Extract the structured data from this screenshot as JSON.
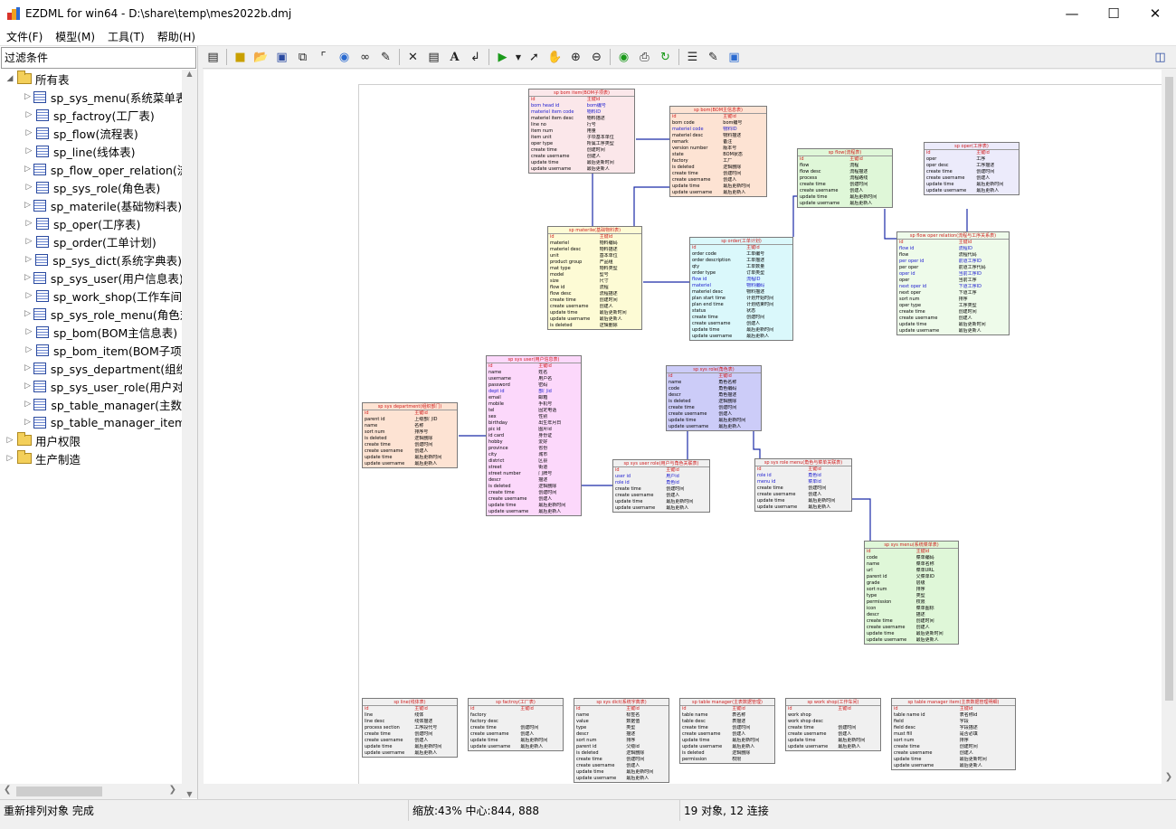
{
  "window": {
    "title": "EZDML for win64 - D:\\share\\temp\\mes2022b.dmj"
  },
  "menu": [
    "文件(F)",
    "模型(M)",
    "工具(T)",
    "帮助(H)"
  ],
  "left_panel": {
    "filter_label": "过滤条件",
    "root": "所有表",
    "tables": [
      "sp_sys_menu(系统菜单表",
      "sp_factroy(工厂表)",
      "sp_flow(流程表)",
      "sp_line(线体表)",
      "sp_flow_oper_relation(流",
      "sp_sys_role(角色表)",
      "sp_materile(基础物料表)",
      "sp_oper(工序表)",
      "sp_order(工单计划)",
      "sp_sys_dict(系统字典表)",
      "sp_sys_user(用户信息表)",
      "sp_work_shop(工作车间",
      "sp_sys_role_menu(角色对",
      "sp_bom(BOM主信息表)",
      "sp_bom_item(BOM子项",
      "sp_sys_department(组织",
      "sp_sys_user_role(用户对",
      "sp_table_manager(主数",
      "sp_table_manager_item"
    ],
    "groups": [
      "用户权限",
      "生产制造"
    ]
  },
  "toolbar_icons": [
    "panel-toggle-icon",
    "new-icon",
    "open-icon",
    "save-icon",
    "copy-model-icon",
    "tree-icon",
    "globe-icon",
    "find-icon",
    "brush-icon",
    "delete-icon",
    "table-icon",
    "text-icon",
    "link-icon",
    "run-icon",
    "run-dropdown-icon",
    "pointer-icon",
    "hand-icon",
    "zoom-in-icon",
    "zoom-out-icon",
    "eye-icon",
    "print-icon",
    "refresh-icon",
    "add-fields-icon",
    "properties-icon",
    "fit-icon",
    "layout-icon"
  ],
  "entities": [
    {
      "title": "sp bom item(BOM子项表)",
      "color": "#fbe7ea",
      "rows": [
        [
          "id",
          "主键id",
          "pk"
        ],
        [
          "bom head id",
          "bom编号",
          "fk"
        ],
        [
          "materiel item code",
          "物料ID",
          "fk"
        ],
        [
          "materiel item desc",
          "物料描述",
          ""
        ],
        [
          "line no",
          "行号",
          ""
        ],
        [
          "item num",
          "用量",
          ""
        ],
        [
          "item unit",
          "子项基本单位",
          ""
        ],
        [
          "oper type",
          "所属工序类型",
          ""
        ],
        [
          "create time",
          "创建时间",
          ""
        ],
        [
          "create username",
          "创建人",
          ""
        ],
        [
          "update time",
          "最后更新时间",
          ""
        ],
        [
          "update username",
          "最后更新人",
          ""
        ]
      ]
    },
    {
      "title": "sp bom(BOM主信息表)",
      "color": "#fde3d3",
      "rows": [
        [
          "id",
          "主键id",
          "pk"
        ],
        [
          "bom code",
          "bom编号",
          ""
        ],
        [
          "materiel code",
          "物料ID",
          "fk"
        ],
        [
          "materiel desc",
          "物料描述",
          ""
        ],
        [
          "remark",
          "备注",
          ""
        ],
        [
          "version number",
          "版本号",
          ""
        ],
        [
          "state",
          "BOM状态",
          ""
        ],
        [
          "factory",
          "工厂",
          ""
        ],
        [
          "is deleted",
          "逻辑删除",
          ""
        ],
        [
          "create time",
          "创建时间",
          ""
        ],
        [
          "create username",
          "创建人",
          ""
        ],
        [
          "update time",
          "最后更新时间",
          ""
        ],
        [
          "update username",
          "最后更新人",
          ""
        ]
      ]
    },
    {
      "title": "sp flow(流程表)",
      "color": "#dff7d8",
      "rows": [
        [
          "id",
          "主键id",
          "pk"
        ],
        [
          "flow",
          "流程",
          ""
        ],
        [
          "flow desc",
          "流程描述",
          ""
        ],
        [
          "process",
          "流程路线",
          ""
        ],
        [
          "create time",
          "创建时间",
          ""
        ],
        [
          "create username",
          "创建人",
          ""
        ],
        [
          "update time",
          "最后更新时间",
          ""
        ],
        [
          "update username",
          "最后更新人",
          ""
        ]
      ]
    },
    {
      "title": "sp oper(工序表)",
      "color": "#ecebfb",
      "rows": [
        [
          "id",
          "主键id",
          "pk"
        ],
        [
          "oper",
          "工序",
          ""
        ],
        [
          "oper desc",
          "工序描述",
          ""
        ],
        [
          "create time",
          "创建时间",
          ""
        ],
        [
          "create username",
          "创建人",
          ""
        ],
        [
          "update time",
          "最后更新时间",
          ""
        ],
        [
          "update username",
          "最后更新人",
          ""
        ]
      ]
    },
    {
      "title": "sp materile(基础物料表)",
      "color": "#fdfbd5",
      "rows": [
        [
          "id",
          "主键id",
          "pk"
        ],
        [
          "materiel",
          "物料编码",
          ""
        ],
        [
          "materiel desc",
          "物料描述",
          ""
        ],
        [
          "unit",
          "基本单位",
          ""
        ],
        [
          "product group",
          "产品组",
          ""
        ],
        [
          "mat type",
          "物料类型",
          ""
        ],
        [
          "model",
          "型号",
          ""
        ],
        [
          "size",
          "尺寸",
          ""
        ],
        [
          "flow id",
          "流程",
          ""
        ],
        [
          "flow desc",
          "流程描述",
          ""
        ],
        [
          "create time",
          "创建时间",
          ""
        ],
        [
          "create username",
          "创建人",
          ""
        ],
        [
          "update time",
          "最后更新时间",
          ""
        ],
        [
          "update username",
          "最后更新人",
          ""
        ],
        [
          "is deleted",
          "逻辑删除",
          ""
        ]
      ]
    },
    {
      "title": "sp order(工单计划)",
      "color": "#daf8fb",
      "rows": [
        [
          "id",
          "主键id",
          "pk"
        ],
        [
          "order code",
          "工单编号",
          ""
        ],
        [
          "order description",
          "工单描述",
          ""
        ],
        [
          "qty",
          "工单数量",
          ""
        ],
        [
          "order type",
          "订单类型",
          ""
        ],
        [
          "flow id",
          "流程ID",
          "fk"
        ],
        [
          "materiel",
          "物料编码",
          "fk"
        ],
        [
          "materiel desc",
          "物料描述",
          ""
        ],
        [
          "plan start time",
          "计划开始时间",
          ""
        ],
        [
          "plan end time",
          "计划结束时间",
          ""
        ],
        [
          "status",
          "状态",
          ""
        ],
        [
          "create time",
          "创建时间",
          ""
        ],
        [
          "create username",
          "创建人",
          ""
        ],
        [
          "update time",
          "最后更新时间",
          ""
        ],
        [
          "update username",
          "最后更新人",
          ""
        ]
      ]
    },
    {
      "title": "sp flow oper relation(流程与工序关系表)",
      "color": "#eefbea",
      "rows": [
        [
          "id",
          "主键id",
          "pk"
        ],
        [
          "flow id",
          "流程ID",
          "fk"
        ],
        [
          "flow",
          "流程代码",
          ""
        ],
        [
          "per oper id",
          "前道工序ID",
          "fk"
        ],
        [
          "per oper",
          "前道工序代码",
          ""
        ],
        [
          "oper id",
          "当前工序ID",
          "fk"
        ],
        [
          "oper",
          "当前工序",
          ""
        ],
        [
          "next oper id",
          "下道工序ID",
          "fk"
        ],
        [
          "next oper",
          "下道工序",
          ""
        ],
        [
          "sort num",
          "排序",
          ""
        ],
        [
          "oper type",
          "工序类型",
          ""
        ],
        [
          "create time",
          "创建时间",
          ""
        ],
        [
          "create username",
          "创建人",
          ""
        ],
        [
          "update time",
          "最后更新时间",
          ""
        ],
        [
          "update username",
          "最后更新人",
          ""
        ]
      ]
    },
    {
      "title": "sp sys user(用户信息表)",
      "color": "#fcd8fb",
      "rows": [
        [
          "id",
          "主键id",
          "pk"
        ],
        [
          "name",
          "姓名",
          ""
        ],
        [
          "username",
          "用户名",
          ""
        ],
        [
          "password",
          "密码",
          ""
        ],
        [
          "dept id",
          "部门id",
          "fk"
        ],
        [
          "email",
          "邮箱",
          ""
        ],
        [
          "mobile",
          "手机号",
          ""
        ],
        [
          "tel",
          "固定电话",
          ""
        ],
        [
          "sex",
          "性别",
          ""
        ],
        [
          "birthday",
          "出生年月日",
          ""
        ],
        [
          "pic id",
          "图片id",
          ""
        ],
        [
          "id card",
          "身份证",
          ""
        ],
        [
          "hobby",
          "爱好",
          ""
        ],
        [
          "province",
          "省份",
          ""
        ],
        [
          "city",
          "城市",
          ""
        ],
        [
          "district",
          "区县",
          ""
        ],
        [
          "street",
          "街道",
          ""
        ],
        [
          "street number",
          "门牌号",
          ""
        ],
        [
          "descr",
          "描述",
          ""
        ],
        [
          "is deleted",
          "逻辑删除",
          ""
        ],
        [
          "create time",
          "创建时间",
          ""
        ],
        [
          "create username",
          "创建人",
          ""
        ],
        [
          "update time",
          "最后更新时间",
          ""
        ],
        [
          "update username",
          "最后更新人",
          ""
        ]
      ]
    },
    {
      "title": "sp sys department(组织部门)",
      "color": "#fde3d3",
      "rows": [
        [
          "id",
          "主键id",
          "pk"
        ],
        [
          "parent id",
          "上级部门ID",
          ""
        ],
        [
          "name",
          "名称",
          ""
        ],
        [
          "sort num",
          "排序号",
          ""
        ],
        [
          "is deleted",
          "逻辑删除",
          ""
        ],
        [
          "create time",
          "创建时间",
          ""
        ],
        [
          "create username",
          "创建人",
          ""
        ],
        [
          "update time",
          "最后更新时间",
          ""
        ],
        [
          "update username",
          "最后更新人",
          ""
        ]
      ]
    },
    {
      "title": "sp sys role(角色表)",
      "color": "#ccccf8",
      "rows": [
        [
          "id",
          "主键id",
          "pk"
        ],
        [
          "name",
          "角色名称",
          ""
        ],
        [
          "code",
          "角色编码",
          ""
        ],
        [
          "descr",
          "角色描述",
          ""
        ],
        [
          "is deleted",
          "逻辑删除",
          ""
        ],
        [
          "create time",
          "创建时间",
          ""
        ],
        [
          "create username",
          "创建人",
          ""
        ],
        [
          "update time",
          "最后更新时间",
          ""
        ],
        [
          "update username",
          "最后更新人",
          ""
        ]
      ]
    },
    {
      "title": "sp sys user role(用户与角色关联表)",
      "color": "#f0f0f0",
      "rows": [
        [
          "id",
          "主键id",
          "pk"
        ],
        [
          "user id",
          "用户id",
          "fk"
        ],
        [
          "role id",
          "角色id",
          "fk"
        ],
        [
          "create time",
          "创建时间",
          ""
        ],
        [
          "create username",
          "创建人",
          ""
        ],
        [
          "update time",
          "最后更新时间",
          ""
        ],
        [
          "update username",
          "最后更新人",
          ""
        ]
      ]
    },
    {
      "title": "sp sys role menu(角色与菜单关联表)",
      "color": "#f0f0f0",
      "rows": [
        [
          "id",
          "主键id",
          "pk"
        ],
        [
          "role id",
          "角色id",
          "fk"
        ],
        [
          "menu id",
          "菜单id",
          "fk"
        ],
        [
          "create time",
          "创建时间",
          ""
        ],
        [
          "create username",
          "创建人",
          ""
        ],
        [
          "update time",
          "最后更新时间",
          ""
        ],
        [
          "update username",
          "最后更新人",
          ""
        ]
      ]
    },
    {
      "title": "sp sys menu(系统菜单表)",
      "color": "#dff7d8",
      "rows": [
        [
          "id",
          "主键id",
          "pk"
        ],
        [
          "code",
          "菜单编码",
          ""
        ],
        [
          "name",
          "菜单名称",
          ""
        ],
        [
          "url",
          "菜单URL",
          ""
        ],
        [
          "parent id",
          "父菜单ID",
          ""
        ],
        [
          "grade",
          "层级",
          ""
        ],
        [
          "sort num",
          "排序",
          ""
        ],
        [
          "type",
          "类型",
          ""
        ],
        [
          "permission",
          "权限",
          ""
        ],
        [
          "icon",
          "菜单图标",
          ""
        ],
        [
          "descr",
          "描述",
          ""
        ],
        [
          "create time",
          "创建时间",
          ""
        ],
        [
          "create username",
          "创建人",
          ""
        ],
        [
          "update time",
          "最后更新时间",
          ""
        ],
        [
          "update username",
          "最后更新人",
          ""
        ]
      ]
    },
    {
      "title": "sp line(线体表)",
      "color": "#f0f0f0",
      "rows": [
        [
          "id",
          "主键id",
          "pk"
        ],
        [
          "line",
          "线体",
          ""
        ],
        [
          "line desc",
          "线体描述",
          ""
        ],
        [
          "process section",
          "工序段代号",
          ""
        ],
        [
          "create time",
          "创建时间",
          ""
        ],
        [
          "create username",
          "创建人",
          ""
        ],
        [
          "update time",
          "最后更新时间",
          ""
        ],
        [
          "update username",
          "最后更新人",
          ""
        ]
      ]
    },
    {
      "title": "sp factroy(工厂表)",
      "color": "#f0f0f0",
      "rows": [
        [
          "id",
          "主键id",
          "pk"
        ],
        [
          "factory",
          "",
          ""
        ],
        [
          "factory desc",
          "",
          ""
        ],
        [
          "create time",
          "创建时间",
          ""
        ],
        [
          "create username",
          "创建人",
          ""
        ],
        [
          "update time",
          "最后更新时间",
          ""
        ],
        [
          "update username",
          "最后更新人",
          ""
        ]
      ]
    },
    {
      "title": "sp sys dict(系统字典表)",
      "color": "#f0f0f0",
      "rows": [
        [
          "id",
          "主键id",
          "pk"
        ],
        [
          "name",
          "标签名",
          ""
        ],
        [
          "value",
          "数据值",
          ""
        ],
        [
          "type",
          "类型",
          ""
        ],
        [
          "descr",
          "描述",
          ""
        ],
        [
          "sort num",
          "排序",
          ""
        ],
        [
          "parent id",
          "父级id",
          ""
        ],
        [
          "is deleted",
          "逻辑删除",
          ""
        ],
        [
          "create time",
          "创建时间",
          ""
        ],
        [
          "create username",
          "创建人",
          ""
        ],
        [
          "update time",
          "最后更新时间",
          ""
        ],
        [
          "update username",
          "最后更新人",
          ""
        ]
      ]
    },
    {
      "title": "sp table manager(主表数据管理)",
      "color": "#f0f0f0",
      "rows": [
        [
          "id",
          "主键id",
          "pk"
        ],
        [
          "table name",
          "表名称",
          ""
        ],
        [
          "table desc",
          "表描述",
          ""
        ],
        [
          "create time",
          "创建时间",
          ""
        ],
        [
          "create username",
          "创建人",
          ""
        ],
        [
          "update time",
          "最后更新时间",
          ""
        ],
        [
          "update username",
          "最后更新人",
          ""
        ],
        [
          "is deleted",
          "逻辑删除",
          ""
        ],
        [
          "permission",
          "权限",
          ""
        ]
      ]
    },
    {
      "title": "sp work shop(工作车间)",
      "color": "#f0f0f0",
      "rows": [
        [
          "id",
          "主键id",
          "pk"
        ],
        [
          "work shop",
          "",
          ""
        ],
        [
          "work shop desc",
          "",
          ""
        ],
        [
          "create time",
          "创建时间",
          ""
        ],
        [
          "create username",
          "创建人",
          ""
        ],
        [
          "update time",
          "最后更新时间",
          ""
        ],
        [
          "update username",
          "最后更新人",
          ""
        ]
      ]
    },
    {
      "title": "sp table manager item(主表数据管理明细)",
      "color": "#f0f0f0",
      "rows": [
        [
          "id",
          "主键id",
          "pk"
        ],
        [
          "table name id",
          "表名称id",
          ""
        ],
        [
          "field",
          "字段",
          ""
        ],
        [
          "field desc",
          "字段描述",
          ""
        ],
        [
          "must fill",
          "是否必填",
          ""
        ],
        [
          "sort num",
          "排序",
          ""
        ],
        [
          "create time",
          "创建时间",
          ""
        ],
        [
          "create username",
          "创建人",
          ""
        ],
        [
          "update time",
          "最后更新时间",
          ""
        ],
        [
          "update username",
          "最后更新人",
          ""
        ]
      ]
    }
  ],
  "status": {
    "left": "重新排列对象 完成",
    "middle": "缩放:43% 中心:844, 888",
    "right": "19 对象, 12 连接"
  }
}
